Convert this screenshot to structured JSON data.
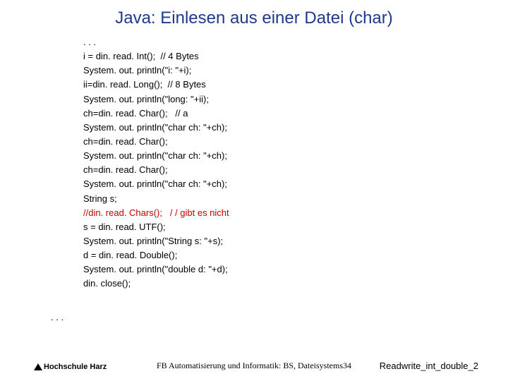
{
  "title": "Java: Einlesen aus einer Datei (char)",
  "code": {
    "l0": ". . .",
    "l1": "i = din. read. Int();  // 4 Bytes",
    "l2": "System. out. println(\"i: \"+i);",
    "l3": "ii=din. read. Long();  // 8 Bytes",
    "l4": "System. out. println(\"long: \"+ii);",
    "l5": "ch=din. read. Char();   // a",
    "l6": "System. out. println(\"char ch: \"+ch);",
    "l7": "ch=din. read. Char();",
    "l8": "System. out. println(\"char ch: \"+ch);",
    "l9": "ch=din. read. Char();",
    "l10": "System. out. println(\"char ch: \"+ch);",
    "l11": "String s;",
    "l12": "//din. read. Chars();   / / gibt es nicht",
    "l13": "s = din. read. UTF();",
    "l14": "System. out. println(\"String s: \"+s);",
    "l15": "d = din. read. Double();",
    "l16": "System. out. println(\"double d: \"+d);",
    "l17": "din. close();"
  },
  "ellipsis_left": ". . .",
  "footer": {
    "logo_text": "Hochschule Harz",
    "center": "FB Automatisierung und Informatik: BS, Dateisystems",
    "page_number": "34",
    "right": "Readwrite_int_double_2"
  }
}
